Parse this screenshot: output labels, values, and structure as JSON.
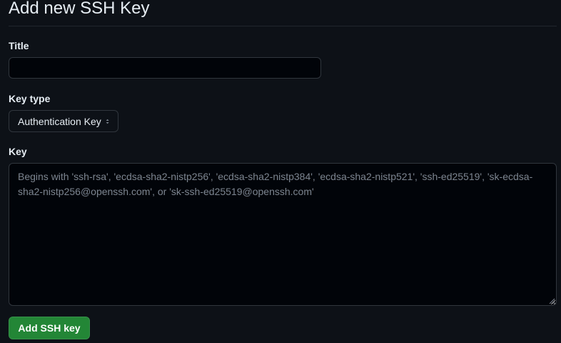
{
  "page": {
    "title": "Add new SSH Key"
  },
  "title_field": {
    "label": "Title",
    "value": "",
    "placeholder": ""
  },
  "key_type": {
    "label": "Key type",
    "selected": "Authentication Key"
  },
  "key_field": {
    "label": "Key",
    "value": "",
    "placeholder": "Begins with 'ssh-rsa', 'ecdsa-sha2-nistp256', 'ecdsa-sha2-nistp384', 'ecdsa-sha2-nistp521', 'ssh-ed25519', 'sk-ecdsa-sha2-nistp256@openssh.com', or 'sk-ssh-ed25519@openssh.com'"
  },
  "submit": {
    "label": "Add SSH key"
  },
  "colors": {
    "background": "#0d1117",
    "input_background": "#010409",
    "border": "#30363d",
    "primary_button": "#238636",
    "text": "#e6edf3",
    "placeholder": "#7d8590"
  }
}
